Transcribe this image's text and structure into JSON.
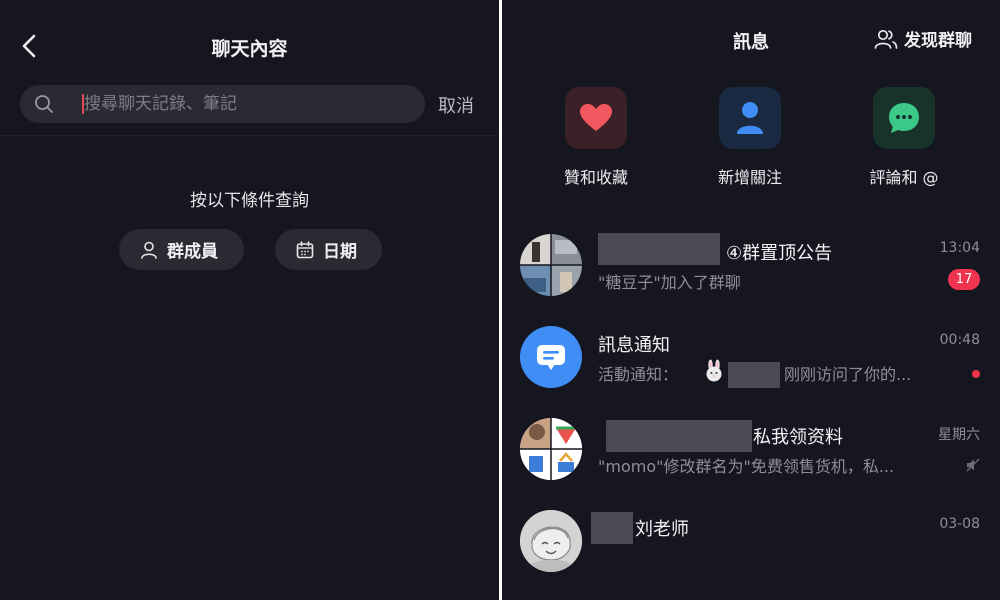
{
  "left": {
    "title": "聊天內容",
    "search": {
      "placeholder": "搜尋聊天記錄、筆記",
      "value": ""
    },
    "cancel_label": "取消",
    "filter_title": "按以下條件查詢",
    "chips": [
      {
        "label": "群成員",
        "icon": "person-icon"
      },
      {
        "label": "日期",
        "icon": "calendar-icon"
      }
    ]
  },
  "right": {
    "title": "訊息",
    "discover_label": "发现群聊",
    "quick_actions": [
      {
        "label": "贊和收藏",
        "icon": "heart-icon",
        "color": "#f2565e"
      },
      {
        "label": "新增關注",
        "icon": "person-icon",
        "color": "#3f8df5"
      },
      {
        "label": "評論和 @",
        "icon": "chat-bubble-icon",
        "color": "#3cc987"
      }
    ],
    "messages": [
      {
        "title": "④群置顶公告",
        "preview": "\"糖豆子\"加入了群聊",
        "time": "13:04",
        "badge": "17"
      },
      {
        "title": "訊息通知",
        "preview_prefix": "活動通知：",
        "preview_suffix": "刚刚访问了你的...",
        "time": "00:48"
      },
      {
        "title": "私我领资料",
        "preview": "\"momo\"修改群名为\"免费领售货机，私...",
        "time": "星期六"
      },
      {
        "title": "刘老师",
        "time": "03-08"
      }
    ]
  }
}
